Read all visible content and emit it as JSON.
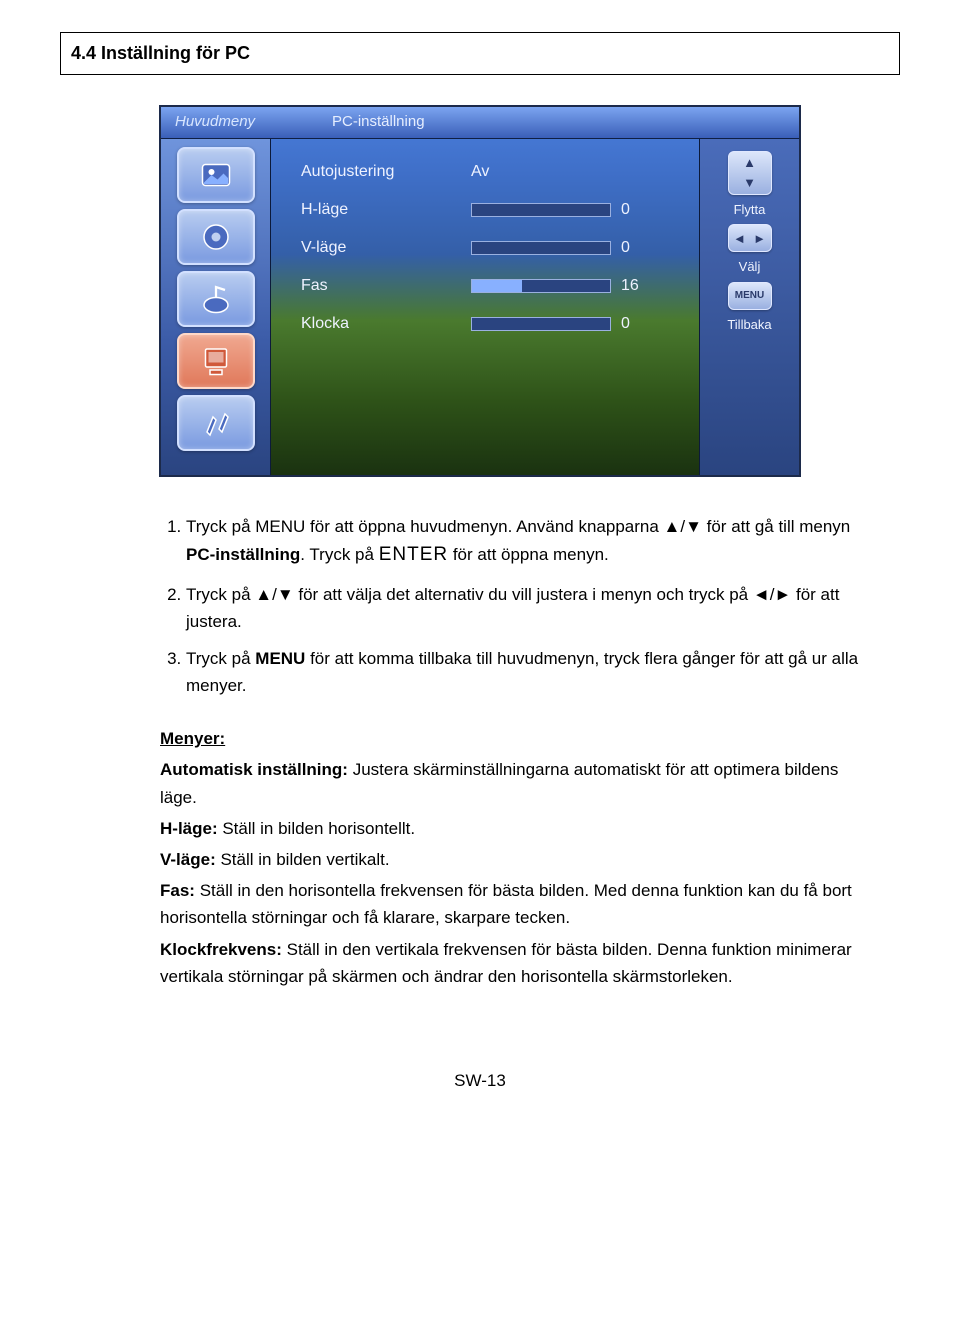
{
  "section_title": "4.4  Inställning för PC",
  "osd": {
    "topbar_left": "Huvudmeny",
    "topbar_right": "PC-inställning",
    "rows": [
      {
        "label": "Autojustering",
        "valueText": "Av",
        "slider": false
      },
      {
        "label": "H-läge",
        "valueText": "0",
        "slider": true,
        "fillPct": 0
      },
      {
        "label": "V-läge",
        "valueText": "0",
        "slider": true,
        "fillPct": 0
      },
      {
        "label": "Fas",
        "valueText": "16",
        "slider": true,
        "fillPct": 36
      },
      {
        "label": "Klocka",
        "valueText": "0",
        "slider": true,
        "fillPct": 0
      }
    ],
    "rightbar": {
      "move_label": "Flytta",
      "select_label": "Välj",
      "menu_key": "MENU",
      "back_label": "Tillbaka"
    }
  },
  "steps": {
    "s1_a": "Tryck på MENU för att öppna huvudmenyn. Använd knapparna ",
    "s1_b": " för att gå till menyn ",
    "s1_menu": "PC-inställning",
    "s1_c": ". Tryck på  ",
    "s1_enter": "ENTER",
    "s1_d": "  för att öppna menyn.",
    "s2_a": "Tryck på ",
    "s2_b": " för att välja det alternativ du vill justera i menyn och tryck på ",
    "s2_c": " för att justera.",
    "s3_a": "Tryck på ",
    "s3_menu": "MENU",
    "s3_b": " för att komma tillbaka till huvudmenyn, tryck flera gånger för att gå ur alla menyer."
  },
  "symbols": {
    "updown": "▲/▼",
    "leftright": "◄/►"
  },
  "menus": {
    "heading": "Menyer:",
    "auto_label": "Automatisk inställning:",
    "auto_text": " Justera skärminställningarna automatiskt för att optimera bildens läge.",
    "h_label": "H-läge:",
    "h_text": " Ställ in bilden horisontellt.",
    "v_label": "V-läge:",
    "v_text": " Ställ in bilden vertikalt.",
    "fas_label": "Fas:",
    "fas_text": " Ställ in den horisontella frekvensen för bästa bilden. Med denna funktion kan du få bort horisontella störningar och få klarare, skarpare tecken.",
    "clk_label": "Klockfrekvens:",
    "clk_text": " Ställ in den vertikala frekvensen för bästa bilden. Denna funktion minimerar vertikala störningar på skärmen och ändrar den horisontella skärmstorleken."
  },
  "page_number": "SW-13"
}
